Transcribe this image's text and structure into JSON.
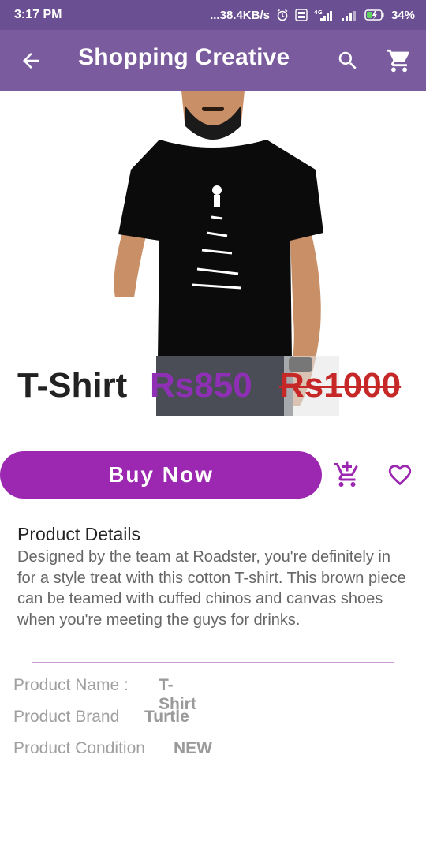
{
  "status_bar": {
    "time": "3:17 PM",
    "network_speed": "...38.4KB/s",
    "network_type": "4G",
    "battery": "34%"
  },
  "app_bar": {
    "title": "Shopping Creative",
    "icons": [
      "arrow-back-icon",
      "search-icon",
      "cart-icon"
    ]
  },
  "product": {
    "name": "T-Shirt",
    "price": "Rs850",
    "original_price": "Rs1000",
    "image_subject": "black-tshirt-model"
  },
  "actions": {
    "buy_now_label": "Buy Now",
    "icons": [
      "add-to-cart-icon",
      "heart-outline-icon"
    ]
  },
  "details": {
    "heading": "Product Details",
    "description": "Designed by the team at Roadster, you're definitely in for a style treat with this cotton T-shirt. This brown piece can be teamed with cuffed chinos and canvas shoes when you're meeting the guys for drinks."
  },
  "specs": [
    {
      "label": "Product Name :",
      "value": "T-Shirt"
    },
    {
      "label": "Product Brand",
      "value": "Turtle"
    },
    {
      "label": "Product Condition",
      "value": "NEW"
    }
  ],
  "colors": {
    "status_bar": "#6a4f93",
    "app_bar": "#7a5c9e",
    "accent": "#9c27b0",
    "price": "#8f2fb5",
    "old_price": "#c62828"
  }
}
